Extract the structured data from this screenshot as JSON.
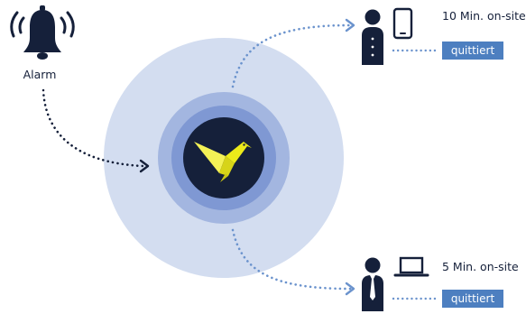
{
  "alarm": {
    "label": "Alarm",
    "icon": "bell-icon"
  },
  "hub": {
    "icon": "bird-icon",
    "bird_color": "#ecea1a"
  },
  "recipients": [
    {
      "time_label": "10 Min. on-site",
      "status_label": "quittiert",
      "person_icon": "person-icon",
      "device_icon": "smartphone-icon"
    },
    {
      "time_label": "5 Min. on-site",
      "status_label": "quittiert",
      "person_icon": "person-with-tie-icon",
      "device_icon": "laptop-icon"
    }
  ],
  "colors": {
    "navy": "#15203a",
    "accent_blue": "#4d7fc0",
    "ring_outer": "#d3ddf0",
    "ring_mid": "#a3b6e0",
    "ring_inner": "#7f98d3",
    "dotted_blue": "#6b93cd"
  }
}
